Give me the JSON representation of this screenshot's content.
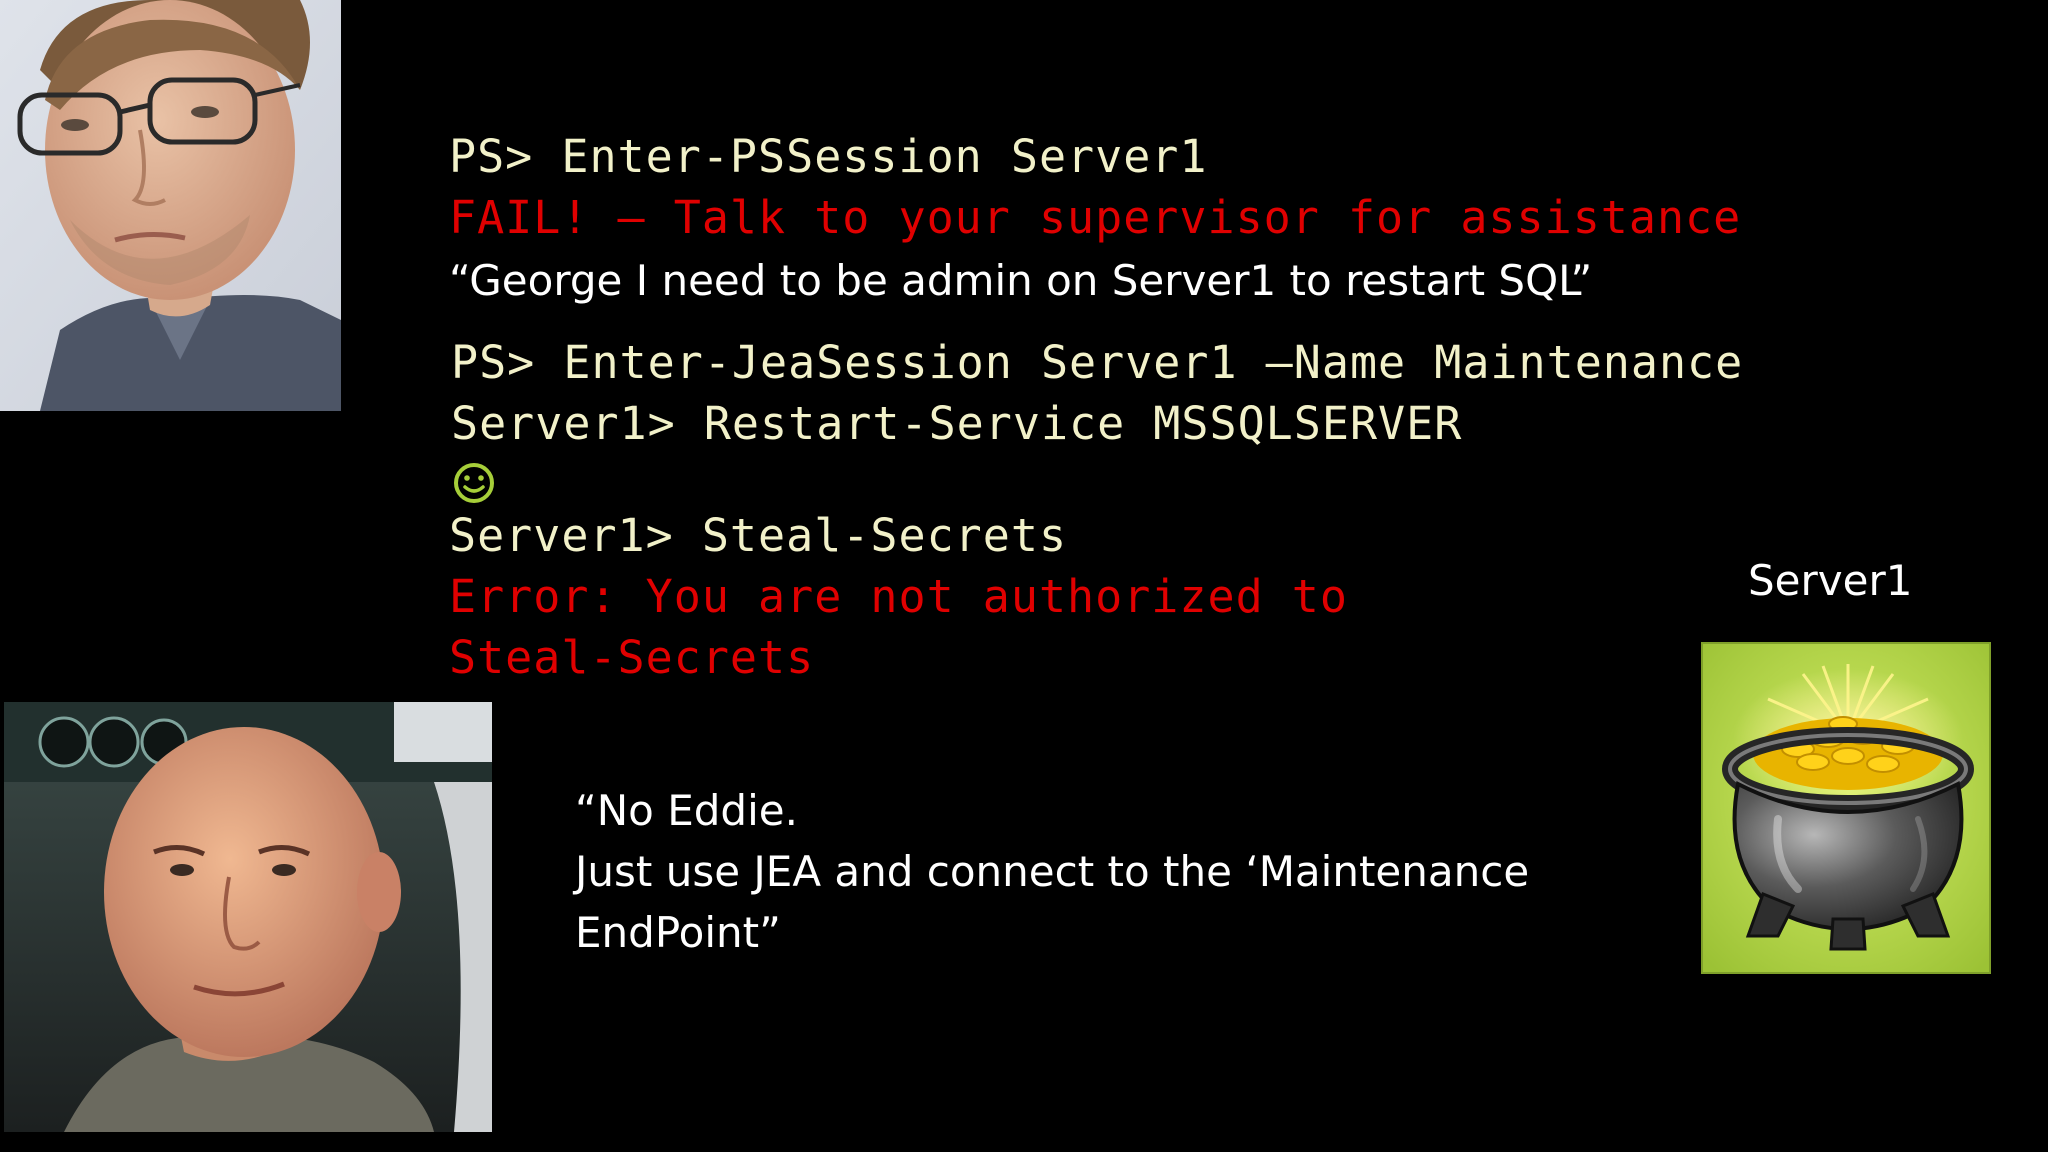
{
  "terminal": {
    "line1": "PS> Enter-PSSession Server1",
    "line2": "FAIL! – Talk to your supervisor for assistance",
    "quote1": "“George I need to be admin on Server1 to restart SQL”",
    "line3": "PS> Enter-JeaSession Server1 –Name Maintenance",
    "line4": "Server1> Restart-Service MSSQLSERVER",
    "smiley_icon": "smiley-face-icon",
    "line5": "Server1> Steal-Secrets",
    "line6": "Error: You are not authorized to",
    "line7": "Steal-Secrets"
  },
  "reply": {
    "line1": "“No Eddie.",
    "line2": "Just use JEA and connect to the ‘Maintenance",
    "line3": "EndPoint”"
  },
  "server": {
    "label": "Server1",
    "icon": "pot-of-gold-icon"
  },
  "colors": {
    "background": "#000000",
    "command": "#f2f1c9",
    "error": "#e00000",
    "speech": "#ffffff",
    "server_bg": "#a6ce39"
  }
}
